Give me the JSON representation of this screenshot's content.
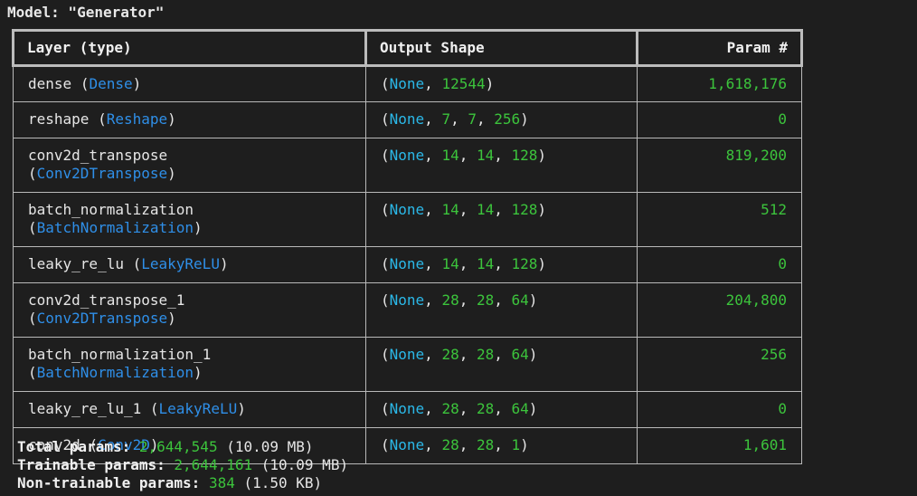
{
  "window": {
    "partial_top_text": "...",
    "partial_bottom_text": "..."
  },
  "model": {
    "title": "Model: \"Generator\""
  },
  "table": {
    "headers": {
      "layer": "Layer (type)",
      "output": "Output Shape",
      "param": "Param #"
    },
    "rows": [
      {
        "name": "dense",
        "type": "Dense",
        "shape": [
          "None",
          "12544"
        ],
        "param": "1,618,176"
      },
      {
        "name": "reshape",
        "type": "Reshape",
        "shape": [
          "None",
          "7",
          "7",
          "256"
        ],
        "param": "0"
      },
      {
        "name": "conv2d_transpose",
        "type": "Conv2DTranspose",
        "shape": [
          "None",
          "14",
          "14",
          "128"
        ],
        "param": "819,200"
      },
      {
        "name": "batch_normalization",
        "type": "BatchNormalization",
        "shape": [
          "None",
          "14",
          "14",
          "128"
        ],
        "param": "512"
      },
      {
        "name": "leaky_re_lu",
        "type": "LeakyReLU",
        "shape": [
          "None",
          "14",
          "14",
          "128"
        ],
        "param": "0"
      },
      {
        "name": "conv2d_transpose_1",
        "type": "Conv2DTranspose",
        "shape": [
          "None",
          "28",
          "28",
          "64"
        ],
        "param": "204,800"
      },
      {
        "name": "batch_normalization_1",
        "type": "BatchNormalization",
        "shape": [
          "None",
          "28",
          "28",
          "64"
        ],
        "param": "256"
      },
      {
        "name": "leaky_re_lu_1",
        "type": "LeakyReLU",
        "shape": [
          "None",
          "28",
          "28",
          "64"
        ],
        "param": "0"
      },
      {
        "name": "conv2d",
        "type": "Conv2D",
        "shape": [
          "None",
          "28",
          "28",
          "1"
        ],
        "param": "1,601"
      }
    ]
  },
  "summary": {
    "total": {
      "label": "Total params:",
      "value": "2,644,545",
      "size": "(10.09 MB)"
    },
    "trainable": {
      "label": "Trainable params:",
      "value": "2,644,161",
      "size": "(10.09 MB)"
    },
    "non_trainable": {
      "label": "Non-trainable params:",
      "value": "384",
      "size": "(1.50 KB)"
    }
  },
  "colors": {
    "background": "#1e1e1e",
    "class_name": "#2f8fe8",
    "none": "#2bb8e8",
    "number": "#3cc43c",
    "border": "#b9b9b9"
  }
}
